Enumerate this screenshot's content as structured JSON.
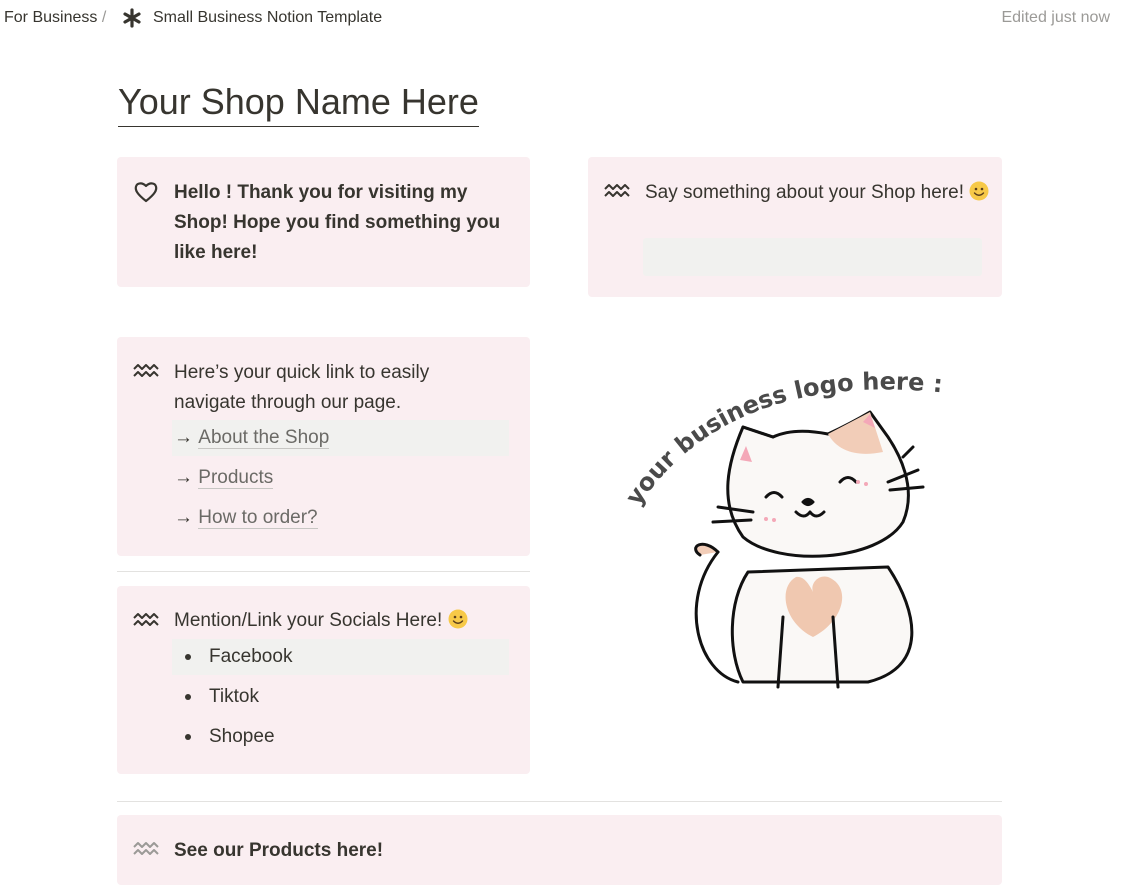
{
  "breadcrumb": {
    "parent": "For Business",
    "separator": "/",
    "current": "Small Business Notion Template"
  },
  "status": {
    "edited": "Edited just now"
  },
  "page": {
    "title": "Your Shop Name Here"
  },
  "callouts": {
    "greeting": {
      "icon": "heart-icon",
      "text": "Hello ! Thank you for visiting my Shop! Hope you find something you like here!"
    },
    "about": {
      "icon": "wave-icon",
      "text": "Say something about your Shop here!"
    },
    "quicklinks": {
      "icon": "wave-icon",
      "intro": "Here’s your quick link to easily navigate through our page.",
      "arrow": "→",
      "links": [
        "About the Shop",
        "Products",
        "How to order?"
      ]
    },
    "socials": {
      "icon": "wave-icon",
      "heading": "Mention/Link your Socials Here!",
      "items": [
        "Facebook",
        "Tiktok",
        "Shopee"
      ]
    },
    "products": {
      "icon": "wave-icon",
      "text": "See our Products here!"
    }
  },
  "logo": {
    "caption": "your business logo here :)"
  },
  "colors": {
    "callout_bg": "#faeef1",
    "text": "#37352f",
    "muted": "#9b9a97",
    "highlight": "#f1f1ef"
  }
}
